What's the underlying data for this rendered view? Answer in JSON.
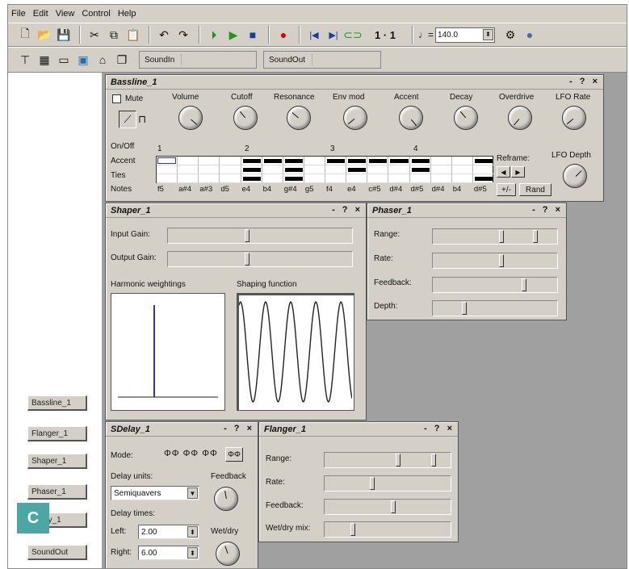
{
  "menu": [
    "File",
    "Edit",
    "View",
    "Control",
    "Help"
  ],
  "toolbar": {
    "position": "1 · 1",
    "tempo_prefix": "♩=",
    "tempo": "140.0",
    "sound_in": "SoundIn",
    "sound_out": "SoundOut"
  },
  "modules": [
    "Bassline_1",
    "Flanger_1",
    "Shaper_1",
    "Phaser_1",
    "Delay_1",
    "SoundOut"
  ],
  "bassline": {
    "title": "Bassline_1",
    "mute": "Mute",
    "knobs": [
      "Volume",
      "Cutoff",
      "Resonance",
      "Env mod",
      "Accent",
      "Decay",
      "Overdrive",
      "LFO Rate"
    ],
    "lfo_depth": "LFO Depth",
    "rows": [
      "On/Off",
      "Accent",
      "Ties",
      "Notes"
    ],
    "bars": [
      "1",
      "2",
      "3",
      "4"
    ],
    "notes": [
      "f5",
      "a#4",
      "a#3",
      "d5",
      "e4",
      "b4",
      "g#4",
      "g5",
      "f4",
      "e4",
      "c#5",
      "d#4",
      "d#5",
      "d#4",
      "b4",
      "d#5"
    ],
    "reframe": "Reframe:",
    "plusminus": "+/-",
    "rand": "Rand"
  },
  "shaper": {
    "title": "Shaper_1",
    "input_gain": "Input Gain:",
    "output_gain": "Output Gain:",
    "harmonic": "Harmonic weightings",
    "shaping": "Shaping function"
  },
  "phaser": {
    "title": "Phaser_1",
    "labels": [
      "Range:",
      "Rate:",
      "Feedback:",
      "Depth:"
    ]
  },
  "sdelay": {
    "title": "SDelay_1",
    "mode": "Mode:",
    "delay_units": "Delay units:",
    "units_value": "Semiquavers",
    "feedback": "Feedback",
    "delay_times": "Delay times:",
    "left": "Left:",
    "left_value": "2.00",
    "right": "Right:",
    "right_value": "6.00",
    "wetdry": "Wet/dry"
  },
  "flanger": {
    "title": "Flanger_1",
    "labels": [
      "Range:",
      "Rate:",
      "Feedback:",
      "Wet/dry mix:"
    ]
  },
  "badge": "C",
  "window_controls": "- ? ×",
  "colors": {
    "accent": "#4aa7a4",
    "plot_line": "#2a3a9a"
  }
}
